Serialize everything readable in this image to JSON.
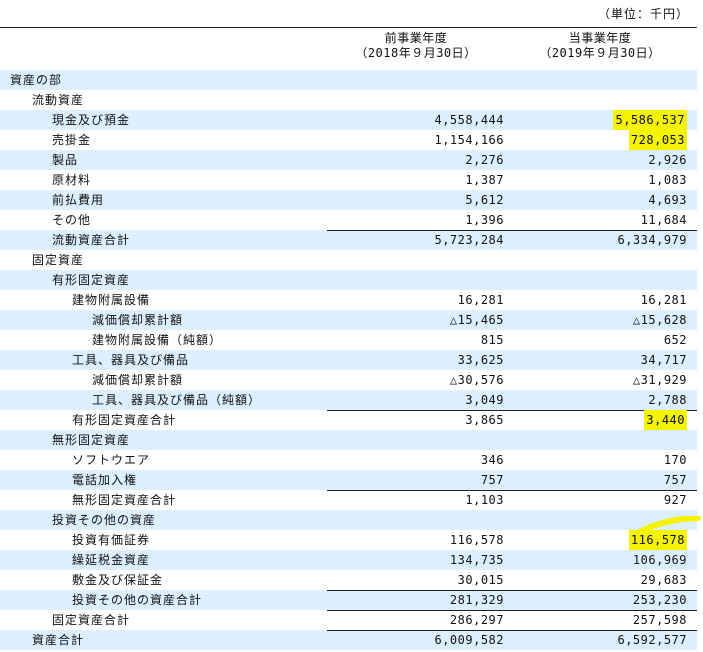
{
  "unit_note": "（単位：千円）",
  "columns": {
    "prev": {
      "line1": "前事業年度",
      "line2": "（2018年９月30日）"
    },
    "curr": {
      "line1": "当事業年度",
      "line2": "（2019年９月30日）"
    }
  },
  "rows": [
    {
      "label": "資産の部",
      "indent": 0,
      "prev": "",
      "curr": ""
    },
    {
      "label": "流動資産",
      "indent": 1,
      "prev": "",
      "curr": ""
    },
    {
      "label": "現金及び預金",
      "indent": 2,
      "prev": "4,558,444",
      "curr": "5,586,537",
      "curr_highlight": true
    },
    {
      "label": "売掛金",
      "indent": 2,
      "prev": "1,154,166",
      "curr": "728,053",
      "curr_highlight": true
    },
    {
      "label": "製品",
      "indent": 2,
      "prev": "2,276",
      "curr": "2,926"
    },
    {
      "label": "原材料",
      "indent": 2,
      "prev": "1,387",
      "curr": "1,083"
    },
    {
      "label": "前払費用",
      "indent": 2,
      "prev": "5,612",
      "curr": "4,693"
    },
    {
      "label": "その他",
      "indent": 2,
      "prev": "1,396",
      "curr": "11,684"
    },
    {
      "label": "流動資産合計",
      "indent": 2,
      "prev": "5,723,284",
      "curr": "6,334,979",
      "top_border": true
    },
    {
      "label": "固定資産",
      "indent": 1,
      "prev": "",
      "curr": ""
    },
    {
      "label": "有形固定資産",
      "indent": 2,
      "prev": "",
      "curr": ""
    },
    {
      "label": "建物附属設備",
      "indent": 3,
      "prev": "16,281",
      "curr": "16,281"
    },
    {
      "label": "減価償却累計額",
      "indent": 4,
      "prev": "△15,465",
      "curr": "△15,628"
    },
    {
      "label": "建物附属設備（純額）",
      "indent": 4,
      "prev": "815",
      "curr": "652"
    },
    {
      "label": "工具、器具及び備品",
      "indent": 3,
      "prev": "33,625",
      "curr": "34,717"
    },
    {
      "label": "減価償却累計額",
      "indent": 4,
      "prev": "△30,576",
      "curr": "△31,929"
    },
    {
      "label": "工具、器具及び備品（純額）",
      "indent": 4,
      "prev": "3,049",
      "curr": "2,788"
    },
    {
      "label": "有形固定資産合計",
      "indent": 3,
      "prev": "3,865",
      "curr": "3,440",
      "curr_highlight": true,
      "top_border": true
    },
    {
      "label": "無形固定資産",
      "indent": 2,
      "prev": "",
      "curr": ""
    },
    {
      "label": "ソフトウエア",
      "indent": 3,
      "prev": "346",
      "curr": "170"
    },
    {
      "label": "電話加入権",
      "indent": 3,
      "prev": "757",
      "curr": "757"
    },
    {
      "label": "無形固定資産合計",
      "indent": 3,
      "prev": "1,103",
      "curr": "927",
      "top_border": true
    },
    {
      "label": "投資その他の資産",
      "indent": 2,
      "prev": "",
      "curr": ""
    },
    {
      "label": "投資有価証券",
      "indent": 3,
      "prev": "116,578",
      "curr": "116,578",
      "curr_highlight": true
    },
    {
      "label": "繰延税金資産",
      "indent": 3,
      "prev": "134,735",
      "curr": "106,969"
    },
    {
      "label": "敷金及び保証金",
      "indent": 3,
      "prev": "30,015",
      "curr": "29,683"
    },
    {
      "label": "投資その他の資産合計",
      "indent": 3,
      "prev": "281,329",
      "curr": "253,230",
      "top_border": true
    },
    {
      "label": "固定資産合計",
      "indent": 2,
      "prev": "286,297",
      "curr": "257,598",
      "top_border": true
    },
    {
      "label": "資産合計",
      "indent": 1,
      "prev": "6,009,582",
      "curr": "6,592,577",
      "top_border": true
    }
  ]
}
